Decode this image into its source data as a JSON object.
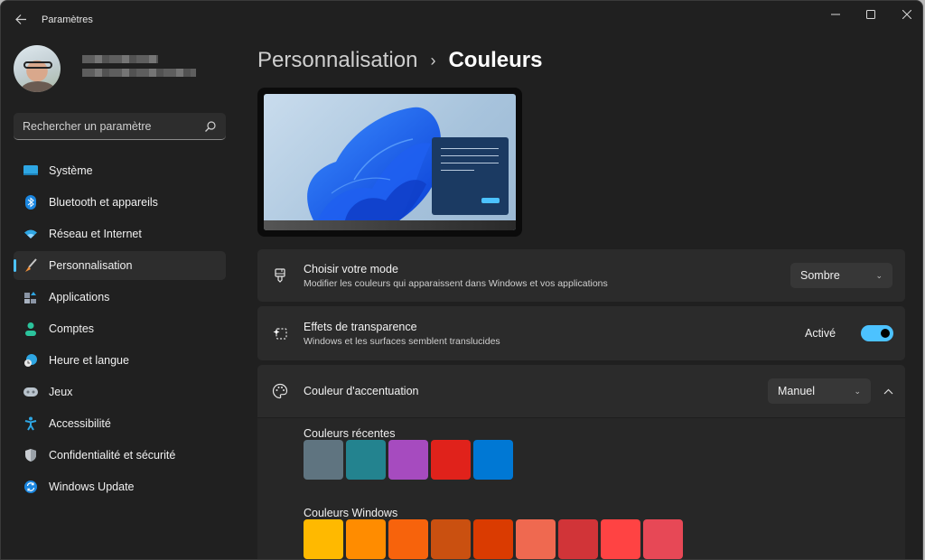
{
  "window": {
    "title": "Paramètres",
    "controls": {
      "minimize": "—",
      "maximize": "▢",
      "close": "✕"
    }
  },
  "profile": {
    "name": "",
    "email": ""
  },
  "search": {
    "placeholder": "Rechercher un paramètre",
    "value": ""
  },
  "sidebar": {
    "items": [
      {
        "label": "Système",
        "icon": "monitor-icon",
        "active": false
      },
      {
        "label": "Bluetooth et appareils",
        "icon": "bluetooth-icon",
        "active": false
      },
      {
        "label": "Réseau et Internet",
        "icon": "wifi-icon",
        "active": false
      },
      {
        "label": "Personnalisation",
        "icon": "paintbrush-icon",
        "active": true
      },
      {
        "label": "Applications",
        "icon": "apps-icon",
        "active": false
      },
      {
        "label": "Comptes",
        "icon": "person-icon",
        "active": false
      },
      {
        "label": "Heure et langue",
        "icon": "clock-globe-icon",
        "active": false
      },
      {
        "label": "Jeux",
        "icon": "gamepad-icon",
        "active": false
      },
      {
        "label": "Accessibilité",
        "icon": "accessibility-icon",
        "active": false
      },
      {
        "label": "Confidentialité et sécurité",
        "icon": "shield-icon",
        "active": false
      },
      {
        "label": "Windows Update",
        "icon": "update-icon",
        "active": false
      }
    ]
  },
  "breadcrumb": {
    "parent": "Personnalisation",
    "separator": "›",
    "current": "Couleurs"
  },
  "settings": {
    "mode": {
      "title": "Choisir votre mode",
      "subtitle": "Modifier les couleurs qui apparaissent dans Windows et vos applications",
      "value": "Sombre"
    },
    "transparency": {
      "title": "Effets de transparence",
      "subtitle": "Windows et les surfaces semblent translucides",
      "state_label": "Activé",
      "enabled": true
    },
    "accent": {
      "title": "Couleur d'accentuation",
      "value": "Manuel",
      "expanded": true,
      "recent_label": "Couleurs récentes",
      "recent_colors": [
        "#5f7480",
        "#23838f",
        "#a64bbf",
        "#e0221b",
        "#0078d4"
      ],
      "windows_label": "Couleurs Windows",
      "windows_colors": [
        "#ffb900",
        "#ff8c00",
        "#f7630c",
        "#ca5010",
        "#da3b01",
        "#ef6950",
        "#d13438",
        "#ff4343",
        "#e74856"
      ]
    }
  },
  "colors": {
    "accent": "#4cc2ff",
    "background": "#202020",
    "card": "#2b2b2b"
  }
}
